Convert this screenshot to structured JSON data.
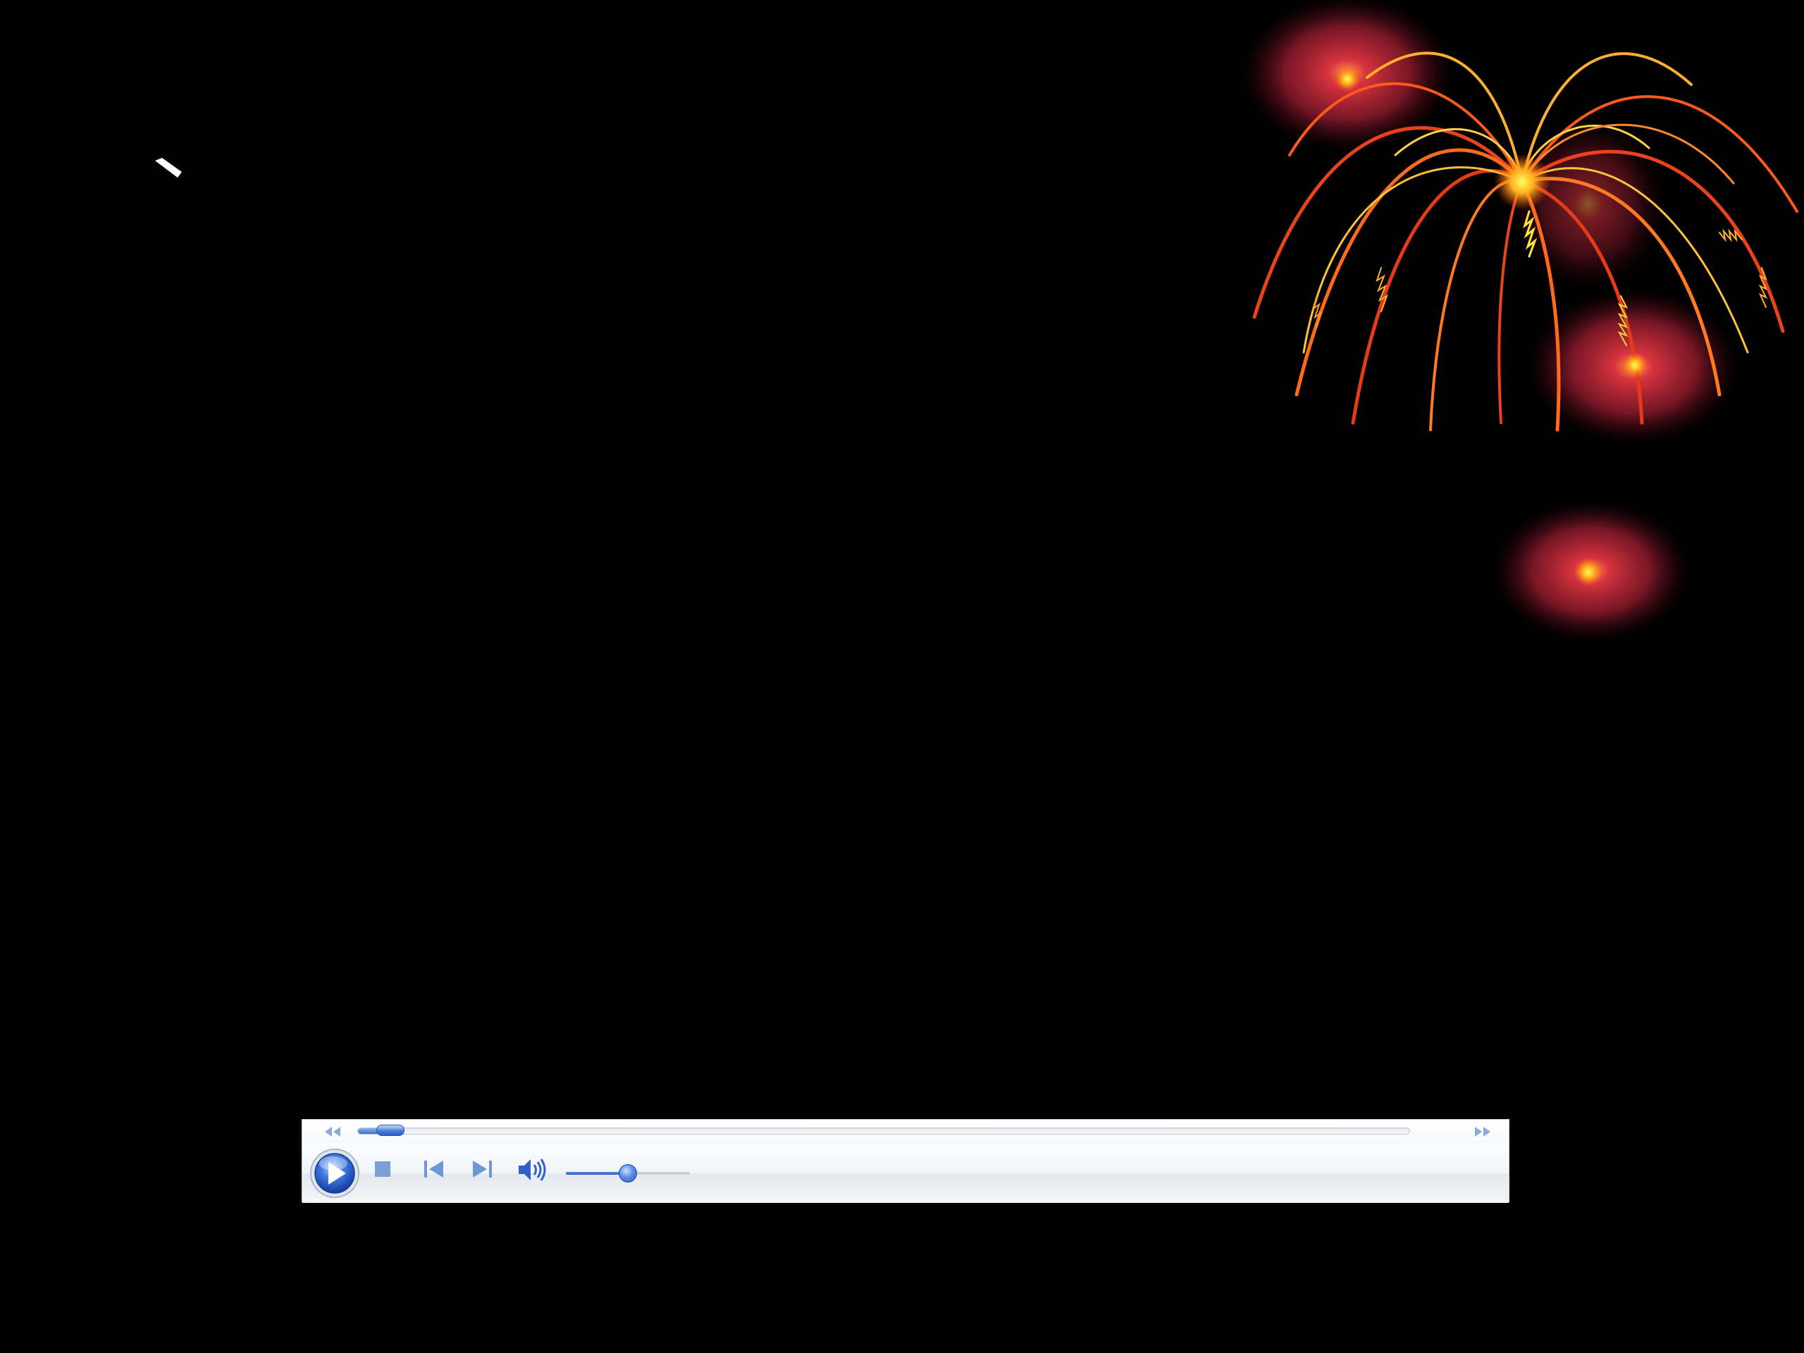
{
  "slide": {
    "background_color": "#000000",
    "decoration": "fireworks-illustration"
  },
  "media_player": {
    "playback_state": "stopped",
    "seek_position_fraction": 0.02,
    "volume_fraction": 0.5,
    "icons": {
      "rewind": "rewind-icon",
      "fast_forward": "fast-forward-icon",
      "play": "play-icon",
      "stop": "stop-icon",
      "previous": "previous-track-icon",
      "next": "next-track-icon",
      "volume": "speaker-icon"
    },
    "colors": {
      "accent": "#2f62c8",
      "bar_background": "#ffffff",
      "button_glyph": "#6f97d8"
    }
  }
}
